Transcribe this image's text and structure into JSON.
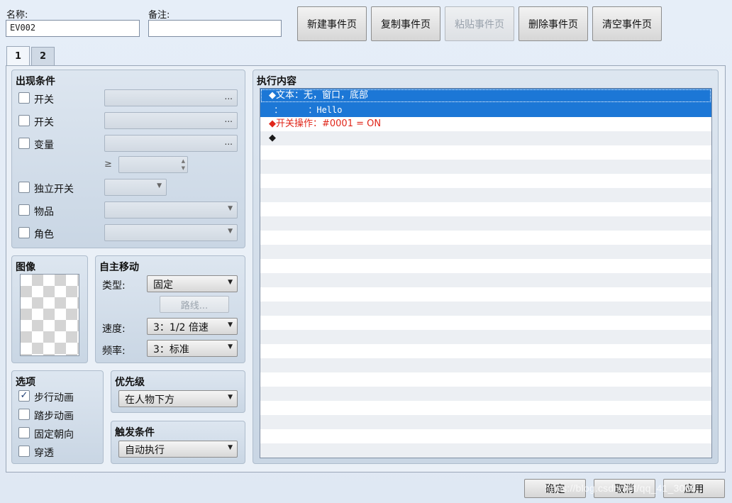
{
  "header": {
    "name_label": "名称:",
    "name_value": "EV002",
    "note_label": "备注:",
    "note_value": "",
    "buttons": [
      {
        "label": "新建事件页",
        "enabled": true
      },
      {
        "label": "复制事件页",
        "enabled": true
      },
      {
        "label": "粘贴事件页",
        "enabled": false
      },
      {
        "label": "删除事件页",
        "enabled": true
      },
      {
        "label": "清空事件页",
        "enabled": true
      }
    ]
  },
  "tabs": [
    {
      "label": "1",
      "active": true
    },
    {
      "label": "2",
      "active": false
    }
  ],
  "conditions": {
    "title": "出现条件",
    "switch1": "开关",
    "switch2": "开关",
    "variable": "变量",
    "gte": "≥",
    "self_switch": "独立开关",
    "item": "物品",
    "actor": "角色",
    "ellipsis": "..."
  },
  "image": {
    "title": "图像"
  },
  "autonomous": {
    "title": "自主移动",
    "type_label": "类型:",
    "type_value": "固定",
    "route_button": "路线...",
    "speed_label": "速度:",
    "speed_value": "3：1/2 倍速",
    "freq_label": "频率:",
    "freq_value": "3：标准"
  },
  "options": {
    "title": "选项",
    "items": [
      {
        "label": "步行动画",
        "checked": true
      },
      {
        "label": "踏步动画",
        "checked": false
      },
      {
        "label": "固定朝向",
        "checked": false
      },
      {
        "label": "穿透",
        "checked": false
      }
    ]
  },
  "priority": {
    "title": "优先级",
    "value": "在人物下方"
  },
  "trigger": {
    "title": "触发条件",
    "value": "自动执行"
  },
  "contents": {
    "title": "执行内容",
    "lines": [
      {
        "text": "◆文本：无，窗口，底部",
        "style": "sel"
      },
      {
        "text": " ：     ：Hello",
        "style": "sel"
      },
      {
        "text": "◆开关操作：#0001 = ON",
        "style": "red"
      },
      {
        "text": "◆",
        "style": "plain"
      }
    ]
  },
  "footer": {
    "ok": "确定",
    "cancel": "取消",
    "apply": "应用",
    "watermark": "https://blog.csdn.net/qq_41_3068"
  },
  "colors": {
    "selection": "#1c77d6",
    "command_red": "#e0261a"
  }
}
